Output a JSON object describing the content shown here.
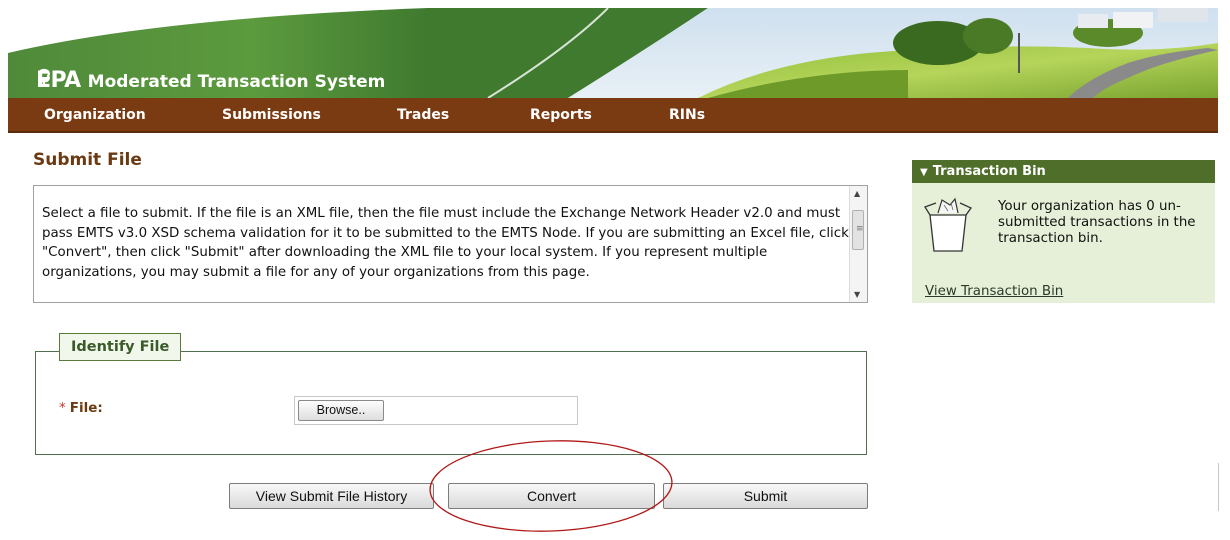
{
  "header": {
    "logo_mark": "EPA",
    "app_title": "Moderated Transaction System"
  },
  "nav": {
    "items": [
      {
        "label": "Organization"
      },
      {
        "label": "Submissions"
      },
      {
        "label": "Trades"
      },
      {
        "label": "Reports"
      },
      {
        "label": "RINs"
      }
    ]
  },
  "page": {
    "title": "Submit File",
    "instructions": "Select a file to submit. If the file is an XML file, then the file must include the Exchange Network Header v2.0 and must pass EMTS v3.0 XSD schema validation for it to be submitted to the EMTS Node. If you are submitting an Excel file, click \"Convert\", then click \"Submit\" after downloading the XML file to your local system. If you represent multiple organizations, you may submit a file for any of your organizations from this page."
  },
  "identify_file": {
    "legend": "Identify File",
    "required_marker": "*",
    "file_label": "File:",
    "browse_label": "Browse..",
    "file_value": ""
  },
  "actions": {
    "history_label": "View Submit File History",
    "convert_label": "Convert",
    "submit_label": "Submit"
  },
  "transaction_bin": {
    "caret": "▼",
    "header": "Transaction Bin",
    "message": "Your organization has 0 un-submitted transactions in the transaction bin.",
    "link": "View Transaction Bin"
  },
  "colors": {
    "nav_bg": "#7a3a12",
    "title_brown": "#6b3a12",
    "bin_header_bg": "#4e6e2a",
    "bin_panel_bg": "#e6f0d8",
    "annotation_red": "#b01818"
  }
}
